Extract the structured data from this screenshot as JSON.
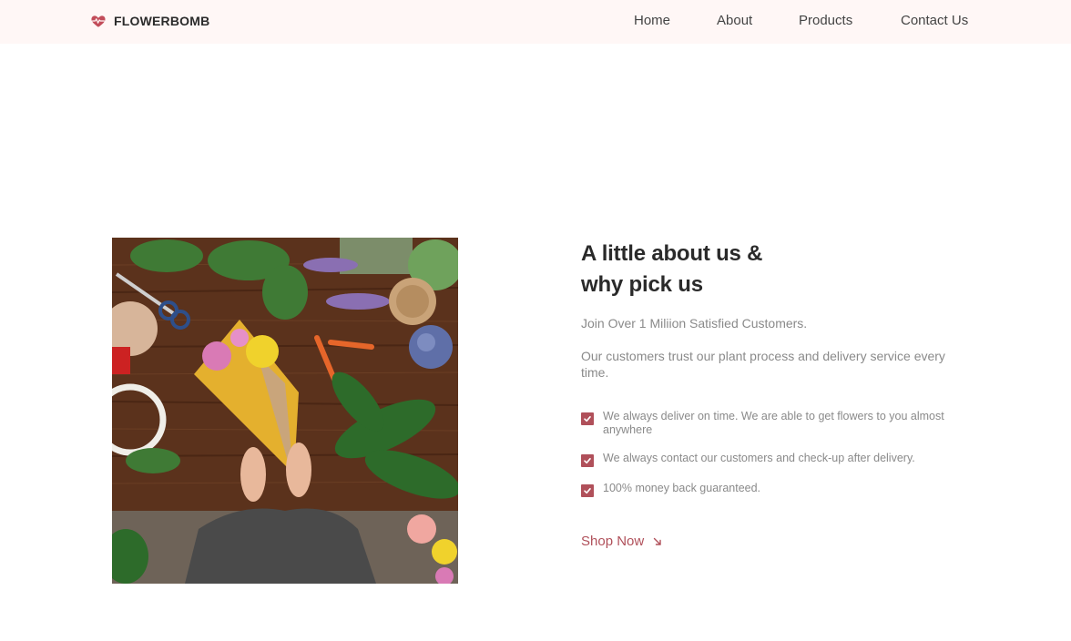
{
  "brand": {
    "name": "FLOWERBOMB",
    "logo_icon": "heart-pulse-icon",
    "accent_color": "#b0505a"
  },
  "nav": {
    "items": [
      {
        "label": "Home"
      },
      {
        "label": "About"
      },
      {
        "label": "Products"
      },
      {
        "label": "Contact Us"
      }
    ]
  },
  "hero": {
    "image_icon": "flower-bouquet-photo",
    "heading_line1": "A little about us &",
    "heading_line2": "why pick us",
    "subtitle": "Join Over 1 Miliion Satisfied Customers.",
    "description": "Our customers trust our plant process and delivery service every time.",
    "checklist": [
      {
        "text": "We always deliver on time. We are able to get flowers to you almost anywhere"
      },
      {
        "text": "We always contact our customers and check-up after delivery."
      },
      {
        "text": "100% money back guaranteed."
      }
    ],
    "cta_label": "Shop Now",
    "cta_icon": "arrow-down-right-icon"
  }
}
